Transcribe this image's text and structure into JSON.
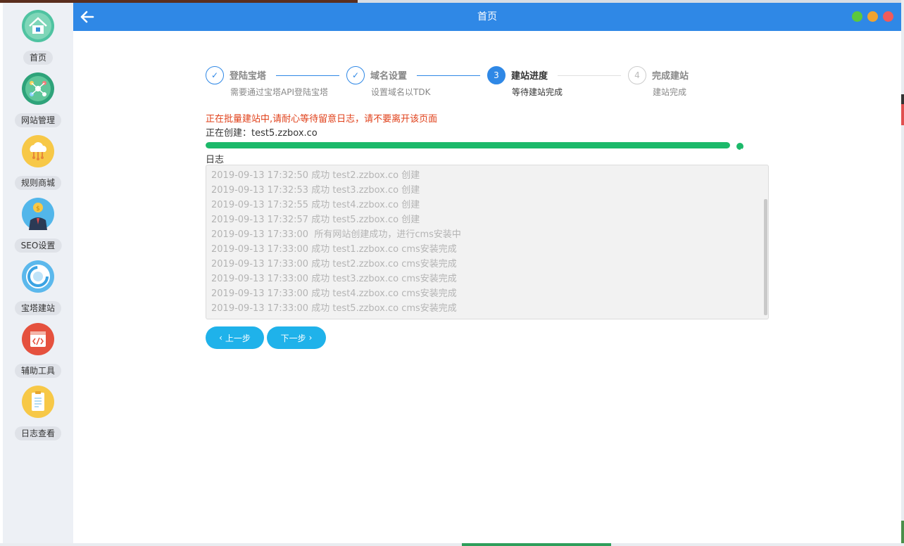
{
  "window": {
    "title": "首页",
    "controls": {
      "min_color": "#5cc83c",
      "max_color": "#f0a330",
      "close_color": "#f05b5b"
    }
  },
  "colors": {
    "accent": "#2f88e6",
    "success": "#1cb96a",
    "warning_text": "#e0401a",
    "button": "#1fb2ea"
  },
  "sidebar": {
    "items": [
      {
        "label": "首页",
        "icon": "home-icon"
      },
      {
        "label": "网站管理",
        "icon": "network-icon"
      },
      {
        "label": "规则商城",
        "icon": "cloud-icon"
      },
      {
        "label": "SEO设置",
        "icon": "seo-person-icon"
      },
      {
        "label": "宝塔建站",
        "icon": "baota-ring-icon"
      },
      {
        "label": "辅助工具",
        "icon": "code-tool-icon"
      },
      {
        "label": "日志查看",
        "icon": "log-doc-icon"
      }
    ]
  },
  "steps": [
    {
      "title": "登陆宝塔",
      "desc": "需要通过宝塔API登陆宝塔",
      "status": "done",
      "marker": "✓"
    },
    {
      "title": "域名设置",
      "desc": "设置域名以TDK",
      "status": "done",
      "marker": "✓"
    },
    {
      "title": "建站进度",
      "desc": "等待建站完成",
      "status": "active",
      "marker": "3"
    },
    {
      "title": "完成建站",
      "desc": "建站完成",
      "status": "todo",
      "marker": "4"
    }
  ],
  "progress": {
    "warning": "正在批量建站中,请耐心等待留意日志，请不要离开该页面",
    "creating_label": "正在创建：",
    "creating_value": "test5.zzbox.co",
    "percent": 100
  },
  "log": {
    "title": "日志",
    "lines": [
      "2019-09-13 17:32:50 成功 test2.zzbox.co 创建",
      "2019-09-13 17:32:53 成功 test3.zzbox.co 创建",
      "2019-09-13 17:32:55 成功 test4.zzbox.co 创建",
      "2019-09-13 17:32:57 成功 test5.zzbox.co 创建",
      "2019-09-13 17:33:00  所有网站创建成功，进行cms安装中",
      "2019-09-13 17:33:00 成功 test1.zzbox.co cms安装完成",
      "2019-09-13 17:33:00 成功 test2.zzbox.co cms安装完成",
      "2019-09-13 17:33:00 成功 test3.zzbox.co cms安装完成",
      "2019-09-13 17:33:00 成功 test4.zzbox.co cms安装完成",
      "2019-09-13 17:33:00 成功 test5.zzbox.co cms安装完成"
    ]
  },
  "buttons": {
    "prev": "上一步",
    "next": "下一步"
  }
}
